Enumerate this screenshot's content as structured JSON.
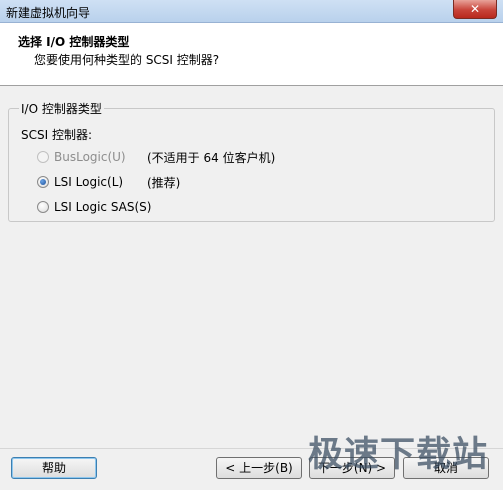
{
  "window": {
    "title": "新建虚拟机向导",
    "close_glyph": "✕"
  },
  "header": {
    "title": "选择 I/O 控制器类型",
    "subtitle": "您要使用何种类型的 SCSI 控制器?"
  },
  "group": {
    "label": "I/O 控制器类型",
    "sub_label": "SCSI 控制器:",
    "options": [
      {
        "label": "BusLogic(U)",
        "note": "(不适用于 64 位客户机)",
        "checked": false,
        "disabled": true
      },
      {
        "label": "LSI Logic(L)",
        "note": "(推荐)",
        "checked": true,
        "disabled": false
      },
      {
        "label": "LSI Logic SAS(S)",
        "note": "",
        "checked": false,
        "disabled": false
      }
    ]
  },
  "buttons": {
    "help": "帮助",
    "back": "< 上一步(B)",
    "next": "下一步(N) >",
    "cancel": "取消"
  },
  "watermark": "极速下载站"
}
